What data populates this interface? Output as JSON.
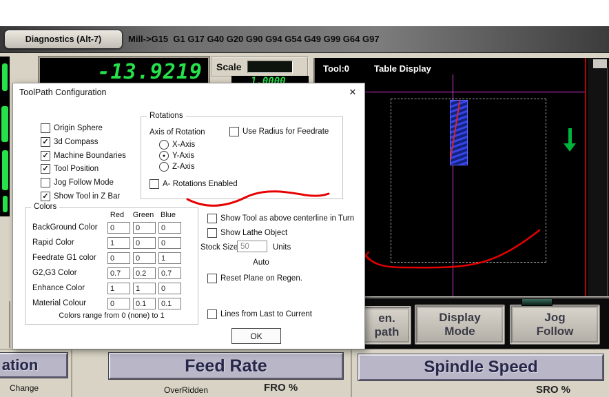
{
  "topbar": {
    "diagnostics_label": "Diagnostics (Alt-7)",
    "gcode_line": "Mill->G15  G1 G17 G40 G20 G90 G94 G54 G49 G99 G64 G97"
  },
  "dro": {
    "axis_value": "-13.9219",
    "scale_label": "Scale",
    "scale_value": "1.0000"
  },
  "toolpath_display": {
    "tool_label": "Tool:0",
    "view_label": "Table Display"
  },
  "panel_buttons": {
    "regen_line1": "en.",
    "regen_line2": "path",
    "display_mode_line1": "Display",
    "display_mode_line2": "Mode",
    "jog_follow_line1": "Jog",
    "jog_follow_line2": "Follow"
  },
  "bottom": {
    "left_partial_label": "ation",
    "change_label": "Change",
    "feed_rate_title": "Feed Rate",
    "overridden_label": "OverRidden",
    "fro_label": "FRO %",
    "spindle_title": "Spindle Speed",
    "sro_label": "SRO %"
  },
  "dialog": {
    "title": "ToolPath Configuration",
    "close_glyph": "✕",
    "left_checks": [
      {
        "label": "Origin Sphere",
        "checked": false,
        "mark": ""
      },
      {
        "label": "3d Compass",
        "checked": true,
        "mark": "✓"
      },
      {
        "label": "Machine Boundaries",
        "checked": true,
        "mark": "✓"
      },
      {
        "label": "Tool Position",
        "checked": true,
        "mark": "✓"
      },
      {
        "label": "Jog Follow Mode",
        "checked": false,
        "mark": ""
      },
      {
        "label": "Show Tool in Z Bar",
        "checked": true,
        "mark": "✓"
      }
    ],
    "rotations": {
      "group_label": "Rotations",
      "axis_label": "Axis of Rotation",
      "radius_check": {
        "label": "Use Radius for Feedrate",
        "checked": false,
        "mark": ""
      },
      "radios": [
        {
          "label": "X-Axis",
          "selected": false,
          "mark": ""
        },
        {
          "label": "Y-Axis",
          "selected": true,
          "mark": "●"
        },
        {
          "label": "Z-Axis",
          "selected": false,
          "mark": ""
        }
      ],
      "a_check": {
        "label": "A- Rotations Enabled",
        "checked": false,
        "mark": ""
      }
    },
    "colors": {
      "group_label": "Colors",
      "headers": [
        "Red",
        "Green",
        "Blue"
      ],
      "rows": [
        {
          "label": "BackGround Color",
          "r": "0",
          "g": "0",
          "b": "0"
        },
        {
          "label": "Rapid Color",
          "r": "1",
          "g": "0",
          "b": "0"
        },
        {
          "label": "Feedrate G1 color",
          "r": "0",
          "g": "0",
          "b": "1"
        },
        {
          "label": "G2,G3 Color",
          "r": "0.7",
          "g": "0.2",
          "b": "0.7"
        },
        {
          "label": "Enhance Color",
          "r": "1",
          "g": "1",
          "b": "0"
        },
        {
          "label": "Material Colour",
          "r": "0",
          "g": "0.1",
          "b": "0.1"
        }
      ],
      "note": "Colors range from 0 (none) to 1"
    },
    "right": {
      "centerline_check": {
        "label": "Show Tool as above centerline in Turn",
        "checked": false,
        "mark": ""
      },
      "lathe_check": {
        "label": "Show Lathe Object",
        "checked": false,
        "mark": ""
      },
      "stock_label": "Stock Size",
      "stock_value": "50",
      "units_label": "Units",
      "auto_label": "Auto",
      "reset_check": {
        "label": "Reset Plane on Regen.",
        "checked": false,
        "mark": ""
      },
      "lines_check": {
        "label": "Lines from Last to Current",
        "checked": false,
        "mark": ""
      }
    },
    "ok_label": "OK"
  },
  "colors_theme": {
    "dro_green": "#25e24a",
    "crosshair_magenta": "#e63ce6",
    "annotation_red": "#e60000",
    "tool_blue": "#3546e8",
    "panel_beige": "#d8d3c4",
    "header_lavender": "#b9b6c7"
  }
}
